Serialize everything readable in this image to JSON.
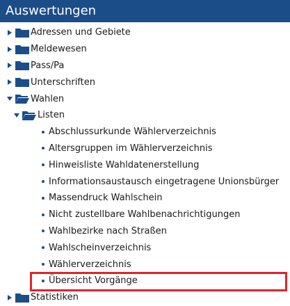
{
  "header": {
    "title": "Auswertungen"
  },
  "tree": {
    "adressen": {
      "label": "Adressen und Gebiete",
      "icon": "folder-closed-icon"
    },
    "meldewesen": {
      "label": "Meldewesen",
      "icon": "folder-closed-icon"
    },
    "pass": {
      "label": "Pass/Pa",
      "icon": "folder-closed-icon"
    },
    "unterschriften": {
      "label": "Unterschriften",
      "icon": "folder-closed-icon"
    },
    "wahlen": {
      "label": "Wahlen",
      "icon": "folder-open-icon",
      "listen": {
        "label": "Listen",
        "icon": "folder-open-icon",
        "items": [
          "Abschlussurkunde Wählerverzeichnis",
          "Altersgruppen im Wählerverzeichnis",
          "Hinweisliste Wahldatenerstellung",
          "Informationsaustausch eingetragene Unionsbürger",
          "Massendruck Wahlschein",
          "Nicht zustellbare Wahlbenachrichtigungen",
          "Wahlbezirke nach Straßen",
          "Wahlscheinverzeichnis",
          "Wählerverzeichnis",
          "Übersicht Vorgänge"
        ]
      }
    },
    "statistiken": {
      "label": "Statistiken",
      "icon": "folder-closed-icon"
    }
  },
  "colors": {
    "header_bg": "#1b4d89",
    "highlight_border": "#e0242a"
  }
}
